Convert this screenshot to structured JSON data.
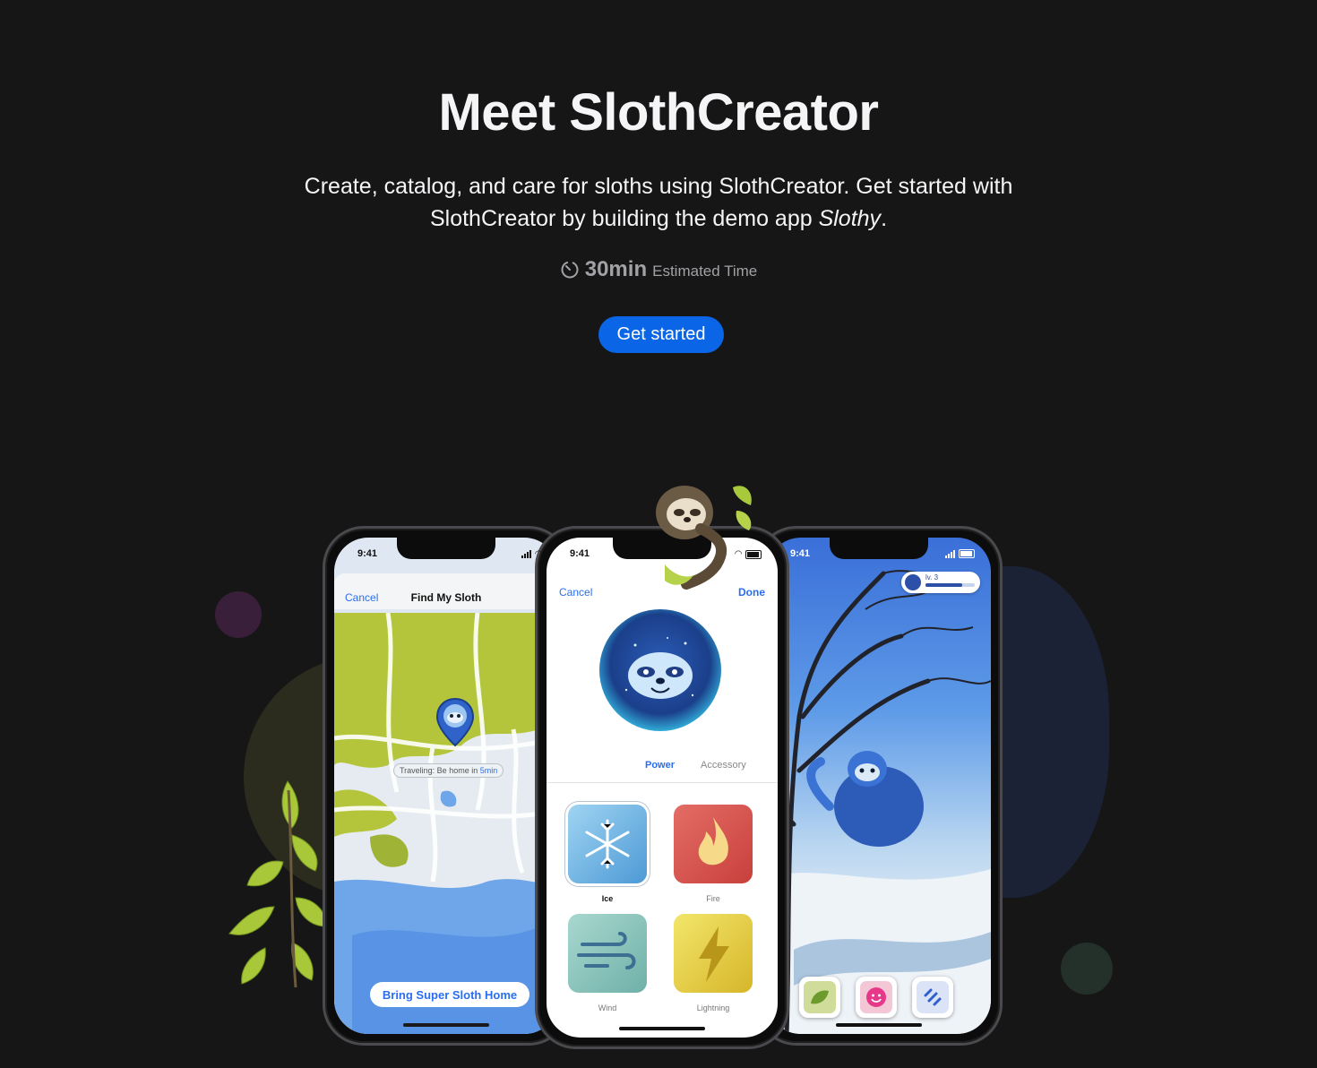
{
  "hero": {
    "title": "Meet SlothCreator",
    "description_before": "Create, catalog, and care for sloths using SlothCreator. Get started with SlothCreator by building the demo app ",
    "description_app": "Slothy",
    "description_after": ".",
    "time_value": "30min",
    "time_label": "Estimated Time",
    "cta_label": "Get started"
  },
  "phone_status_time": "9:41",
  "phone_map": {
    "cancel": "Cancel",
    "title": "Find My Sloth",
    "travel_prefix": "Traveling: Be home in ",
    "travel_eta": "5min",
    "action": "Bring Super Sloth Home"
  },
  "phone_customize": {
    "cancel": "Cancel",
    "done": "Done",
    "tabs": [
      "Power",
      "Accessory"
    ],
    "powers": [
      "Ice",
      "Fire",
      "Wind",
      "Lightning"
    ]
  },
  "phone_habitat": {
    "level": "lv. 3",
    "level_progress": 0.75
  },
  "colors": {
    "accent": "#0a66e6",
    "background": "#161616"
  }
}
